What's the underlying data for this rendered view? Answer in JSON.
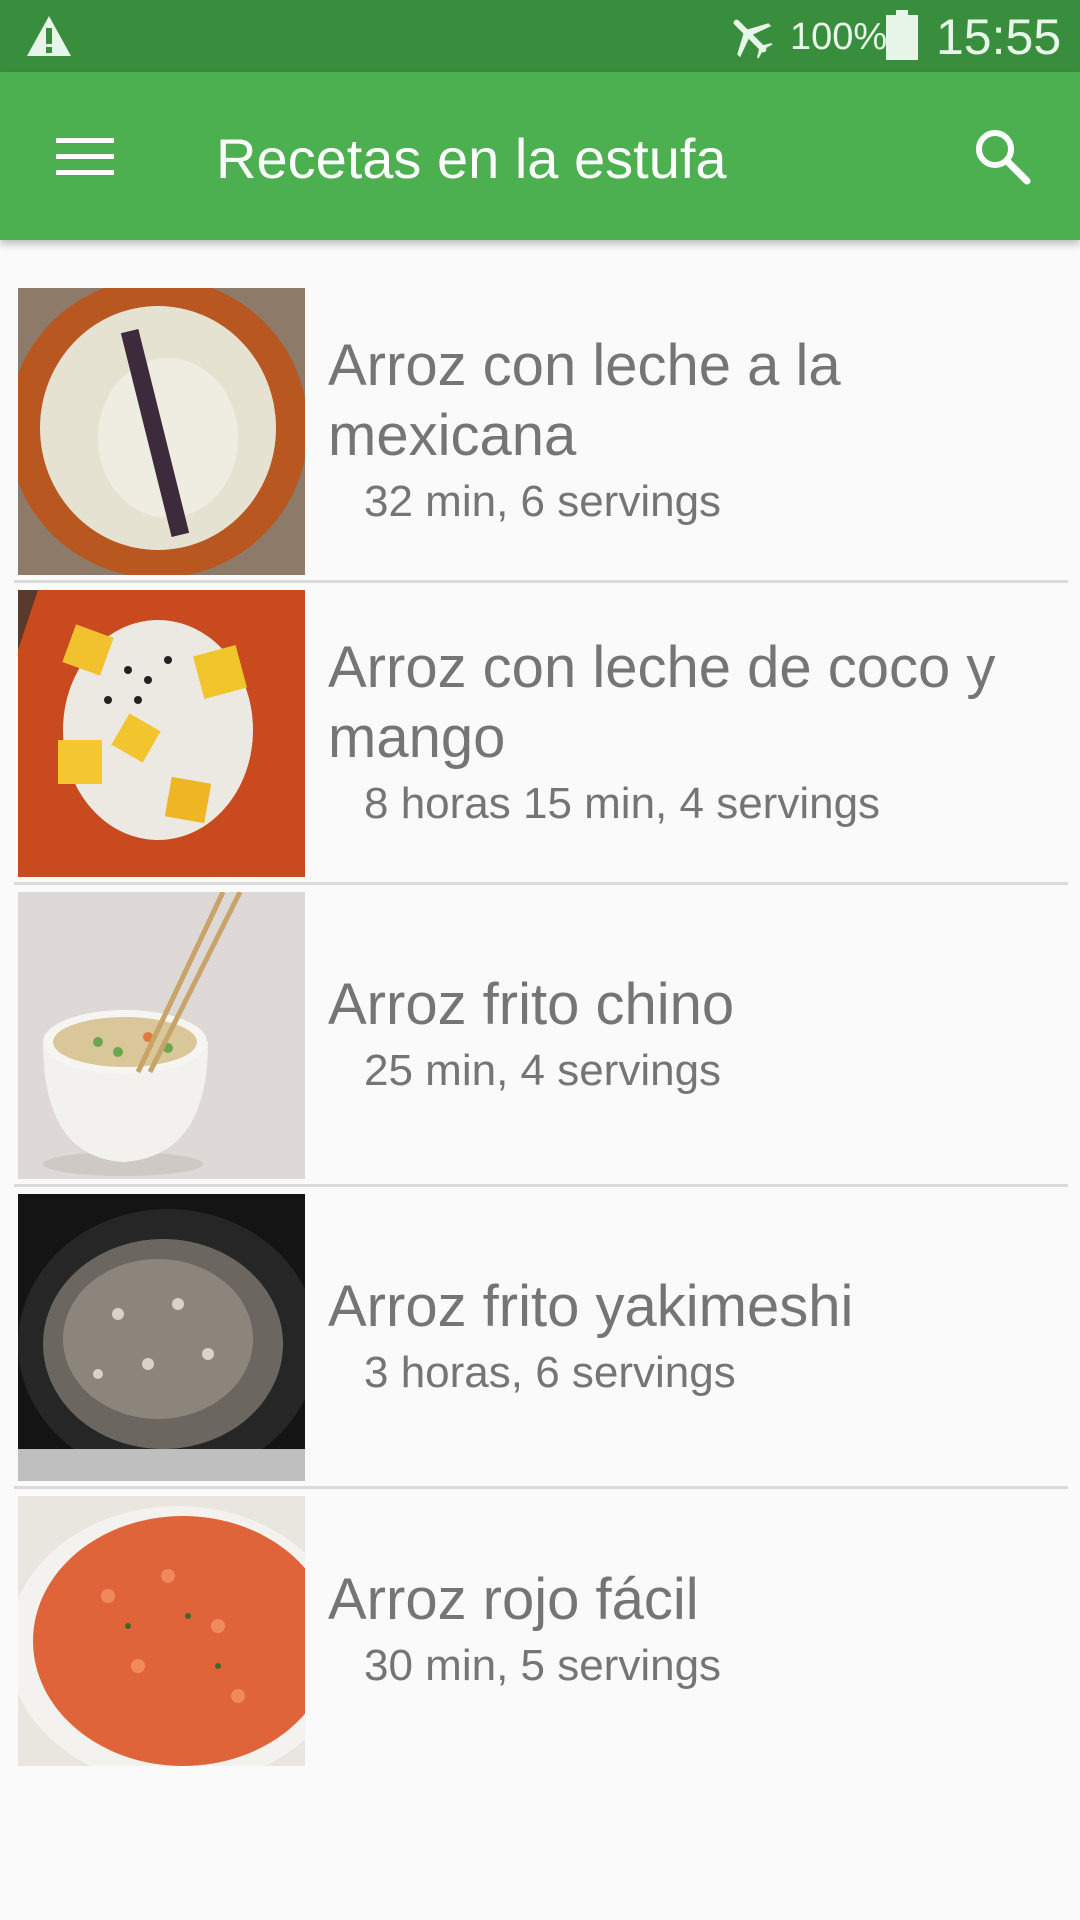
{
  "status_bar": {
    "battery_percent": "100%",
    "time": "15:55",
    "icons": [
      "warning-icon",
      "airplane-mode-icon",
      "battery-icon"
    ]
  },
  "app_bar": {
    "title": "Recetas en la estufa",
    "icons": [
      "menu-icon",
      "search-icon"
    ]
  },
  "recipes": [
    {
      "name": "Arroz con leche a la mexicana",
      "meta": "32 min, 6 servings"
    },
    {
      "name": "Arroz con leche de coco y mango",
      "meta": "8 horas 15 min, 4 servings"
    },
    {
      "name": "Arroz frito chino",
      "meta": "25 min, 4 servings"
    },
    {
      "name": "Arroz frito yakimeshi",
      "meta": "3 horas, 6 servings"
    },
    {
      "name": "Arroz rojo fácil",
      "meta": "30 min, 5 servings"
    }
  ],
  "colors": {
    "status_bar": "#388e3c",
    "app_bar": "#4caf50",
    "text_secondary": "#757575",
    "background": "#fafafa"
  }
}
